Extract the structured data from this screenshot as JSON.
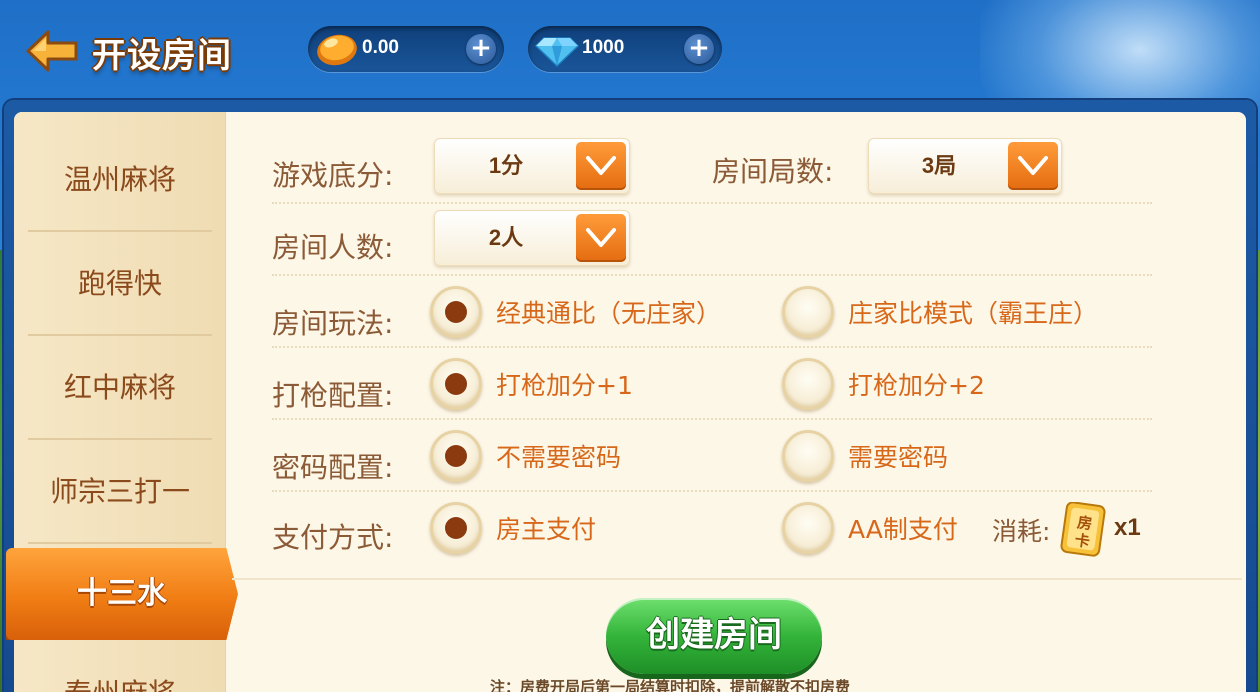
{
  "header": {
    "title": "开设房间",
    "coins": {
      "value": "0.00",
      "plus": "+"
    },
    "gems": {
      "value": "1000",
      "plus": "+"
    }
  },
  "sidebar": {
    "items": [
      "温州麻将",
      "跑得快",
      "红中麻将",
      "师宗三打一",
      "十三水",
      "泰州麻将"
    ],
    "active_index": 4
  },
  "form": {
    "base_score": {
      "label": "游戏底分:",
      "value": "1分"
    },
    "rounds": {
      "label": "房间局数:",
      "value": "3局"
    },
    "players": {
      "label": "房间人数:",
      "value": "2人"
    },
    "play_mode": {
      "label": "房间玩法:",
      "options": [
        "经典通比（无庄家）",
        "庄家比模式（霸王庄）"
      ],
      "selected": 0
    },
    "gun_config": {
      "label": "打枪配置:",
      "options": [
        "打枪加分+1",
        "打枪加分+2"
      ],
      "selected": 0
    },
    "password_config": {
      "label": "密码配置:",
      "options": [
        "不需要密码",
        "需要密码"
      ],
      "selected": 0
    },
    "payment": {
      "label": "支付方式:",
      "options": [
        "房主支付",
        "AA制支付"
      ],
      "selected": 0
    },
    "cost": {
      "label": "消耗:",
      "card_text": "房卡",
      "quantity": "x1"
    }
  },
  "create_button": {
    "label": "创建房间"
  },
  "note": "注：房费开局后第一局结算时扣除，提前解散不扣房费",
  "colors": {
    "accent_orange": "#f07d14",
    "button_green": "#34b43a",
    "label_brown": "#8b5a36",
    "option_orange": "#d7681a"
  }
}
